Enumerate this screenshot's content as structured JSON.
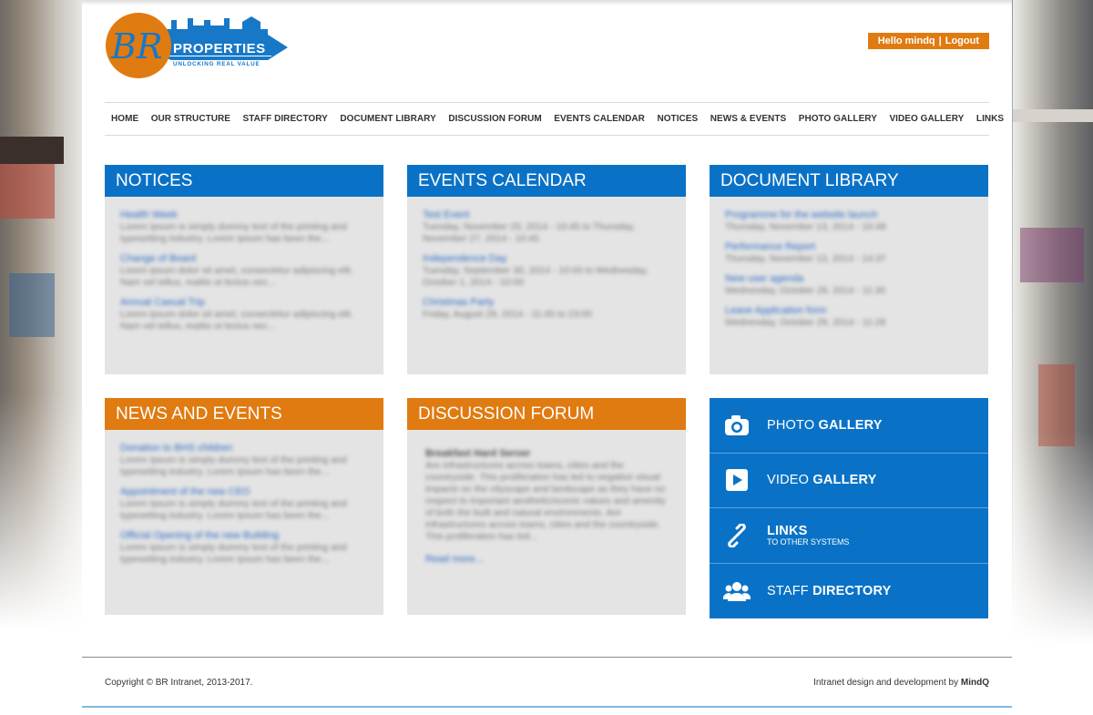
{
  "header": {
    "logo": {
      "monogram": "BR",
      "name": "PROPERTIES",
      "tagline": "UNLOCKING REAL VALUE"
    },
    "user": {
      "greeting": "Hello mindq",
      "separator": "|",
      "logout": "Logout"
    }
  },
  "nav": {
    "items": [
      "HOME",
      "OUR STRUCTURE",
      "STAFF DIRECTORY",
      "DOCUMENT LIBRARY",
      "DISCUSSION FORUM",
      "EVENTS CALENDAR",
      "NOTICES",
      "NEWS & EVENTS",
      "PHOTO GALLERY",
      "VIDEO GALLERY",
      "LINKS"
    ]
  },
  "notices": {
    "title": "NOTICES",
    "items": [
      {
        "t": "Health Week",
        "d": "Lorem Ipsum is simply dummy text of the printing and typesetting industry. Lorem Ipsum has been the..."
      },
      {
        "t": "Change of Board",
        "d": "Lorem ipsum dolor sit amet, consectetur adipiscing elit. Nam vel tellus, mattis ut lectus nec..."
      },
      {
        "t": "Annual Casual Trip",
        "d": "Lorem ipsum dolor sit amet, consectetur adipiscing elit. Nam vel tellus, mattis ut lectus nec..."
      }
    ]
  },
  "events": {
    "title": "EVENTS CALENDAR",
    "items": [
      {
        "t": "Test Event",
        "d": "Tuesday, November 25, 2014 - 10:45 to Thursday, November 27, 2014 - 10:45"
      },
      {
        "t": "Independence Day",
        "d": "Tuesday, September 30, 2014 - 10:00 to Wednesday, October 1, 2014 - 10:00"
      },
      {
        "t": "Christmas Party",
        "d": "Friday, August 29, 2014 - 11:45 to 23:00"
      }
    ]
  },
  "documents": {
    "title": "DOCUMENT LIBRARY",
    "items": [
      {
        "t": "Programme for the website launch",
        "d": "Thursday, November 13, 2014 - 10:48"
      },
      {
        "t": "Performance Report",
        "d": "Thursday, November 13, 2014 - 14:37"
      },
      {
        "t": "New user agenda",
        "d": "Wednesday, October 29, 2014 - 11:30"
      },
      {
        "t": "Leave Application form",
        "d": "Wednesday, October 29, 2014 - 11:28"
      }
    ]
  },
  "news": {
    "title": "NEWS AND EVENTS",
    "items": [
      {
        "t": "Donation to BHS children",
        "d": "Lorem Ipsum is simply dummy text of the printing and typesetting industry. Lorem Ipsum has been the..."
      },
      {
        "t": "Appointment of the new CEO",
        "d": "Lorem Ipsum is simply dummy text of the printing and typesetting industry. Lorem Ipsum has been the..."
      },
      {
        "t": "Official Opening of the new Building",
        "d": "Lorem Ipsum is simply dummy text of the printing and typesetting industry. Lorem Ipsum has been the..."
      }
    ]
  },
  "forum": {
    "title": "DISCUSSION FORUM",
    "post_title": "Breakfast Hard Server",
    "post_text": "Are infrastructures across towns, cities and the countryside. This proliferation has led to negative visual impacts on the cityscape and landscape as they have no respect to important aesthetic/scenic values and amenity of both the built and natural environments. Are infrastructures across towns, cities and the countryside. This proliferation has led...",
    "read_more": "Read more..."
  },
  "quick_links": [
    {
      "icon": "camera-icon",
      "label": "PHOTO ",
      "bold": "GALLERY",
      "sub": ""
    },
    {
      "icon": "video-play-icon",
      "label": "VIDEO ",
      "bold": "GALLERY",
      "sub": ""
    },
    {
      "icon": "link-icon",
      "label": "",
      "bold": "LINKS",
      "sub": "TO OTHER SYSTEMS"
    },
    {
      "icon": "people-icon",
      "label": "STAFF ",
      "bold": "DIRECTORY",
      "sub": ""
    }
  ],
  "footer": {
    "copyright": "Copyright © BR Intranet, 2013-2017.",
    "credit_prefix": "Intranet design and development by ",
    "credit_brand": "MindQ"
  },
  "colors": {
    "blue": "#0a72c6",
    "orange": "#e07b11"
  }
}
